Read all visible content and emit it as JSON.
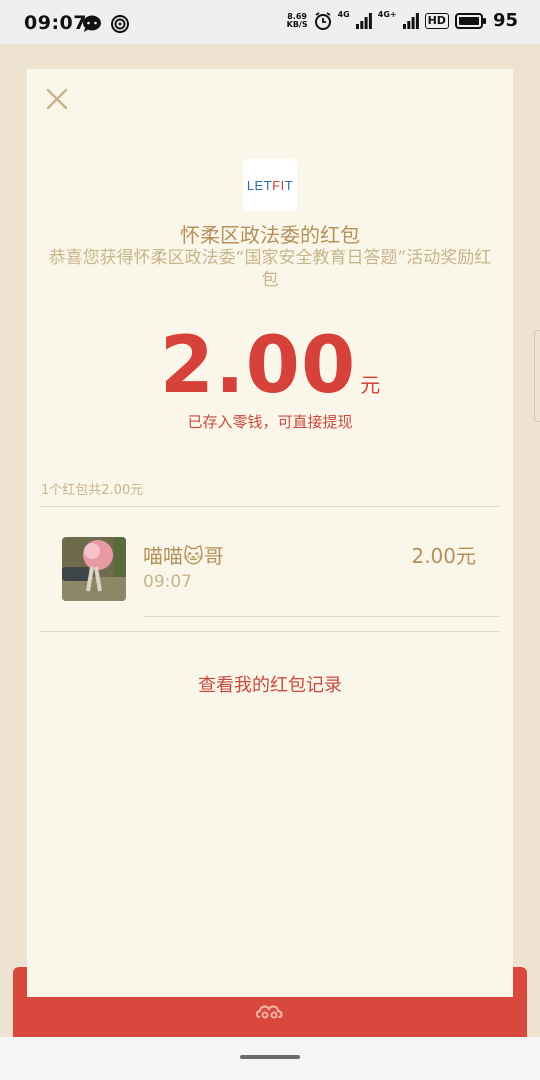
{
  "status_bar": {
    "time": "09:07",
    "speed_value": "8.69",
    "speed_unit": "KB/S",
    "network_1": "4G",
    "network_2": "4G+",
    "hd": "HD",
    "battery_level": "95",
    "icons": [
      "chat-bubble-icon",
      "hotspot-icon",
      "alarm-icon",
      "signal-icon",
      "signal-icon",
      "battery-icon"
    ]
  },
  "card": {
    "logo_text_1": "LET",
    "logo_text_2": "FI",
    "logo_text_3": "T",
    "title": "怀柔区政法委的红包",
    "subtitle": "恭喜您获得怀柔区政法委“国家安全教育日答题”活动奖励红包",
    "amount": "2.00",
    "unit": "元",
    "deposited_note": "已存入零钱，可直接提现",
    "count_line": "1个红包共2.00元",
    "history_link": "查看我的红包记录"
  },
  "recipients": [
    {
      "name": "喵喵🐱哥",
      "time": "09:07",
      "amount": "2.00元"
    }
  ],
  "colors": {
    "accent_red": "#d6423a",
    "gold_text": "#b4915a",
    "card_bg": "#fbf6ea",
    "page_bg": "#ede3d0"
  }
}
